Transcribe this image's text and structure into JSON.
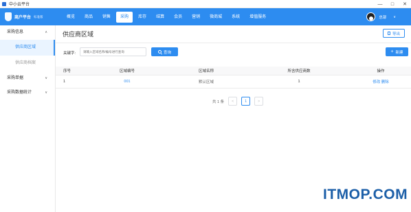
{
  "window": {
    "title": "中小云平台",
    "controls": [
      "—",
      "□",
      "✕"
    ]
  },
  "header": {
    "logo_text": "商户平台",
    "logo_sub": "标准版",
    "nav": [
      {
        "label": "概览"
      },
      {
        "label": "商品"
      },
      {
        "label": "销售"
      },
      {
        "label": "采购",
        "active": true
      },
      {
        "label": "库存"
      },
      {
        "label": "结算"
      },
      {
        "label": "会员"
      },
      {
        "label": "营销"
      },
      {
        "label": "微商城"
      },
      {
        "label": "系统"
      },
      {
        "label": "增值服务"
      }
    ],
    "user_name": "总部",
    "user_caret": "∨"
  },
  "sidebar": {
    "groups": [
      {
        "label": "采购信息",
        "chevron": "∧",
        "items": [
          {
            "label": "供应商区域",
            "active": true
          },
          {
            "label": "供应商档案"
          }
        ]
      },
      {
        "label": "采购单据",
        "chevron": "∨"
      },
      {
        "label": "采购数据统计",
        "chevron": "∨"
      }
    ]
  },
  "main": {
    "title": "供应商区域",
    "export_label": "导出",
    "keyword_label": "关键字:",
    "search_placeholder": "请输入区域名称/编号进行查询",
    "query_label": "查询",
    "new_label": "新建",
    "table": {
      "headers": [
        "序号",
        "区域编号",
        "区域名称",
        "所含供应商数",
        "操作"
      ],
      "rows": [
        {
          "seq": "1",
          "code": "001",
          "name": "默认区域",
          "count": "1",
          "edit": "修改",
          "delete": "删除"
        }
      ]
    },
    "pagination": {
      "total": "共 1 条",
      "prev": "<",
      "current": "1",
      "next": ">"
    }
  },
  "watermark": "ITMOP.COM",
  "colors": {
    "primary": "#2d8cf0",
    "sidebar_active_bg": "#eaf4ff"
  }
}
